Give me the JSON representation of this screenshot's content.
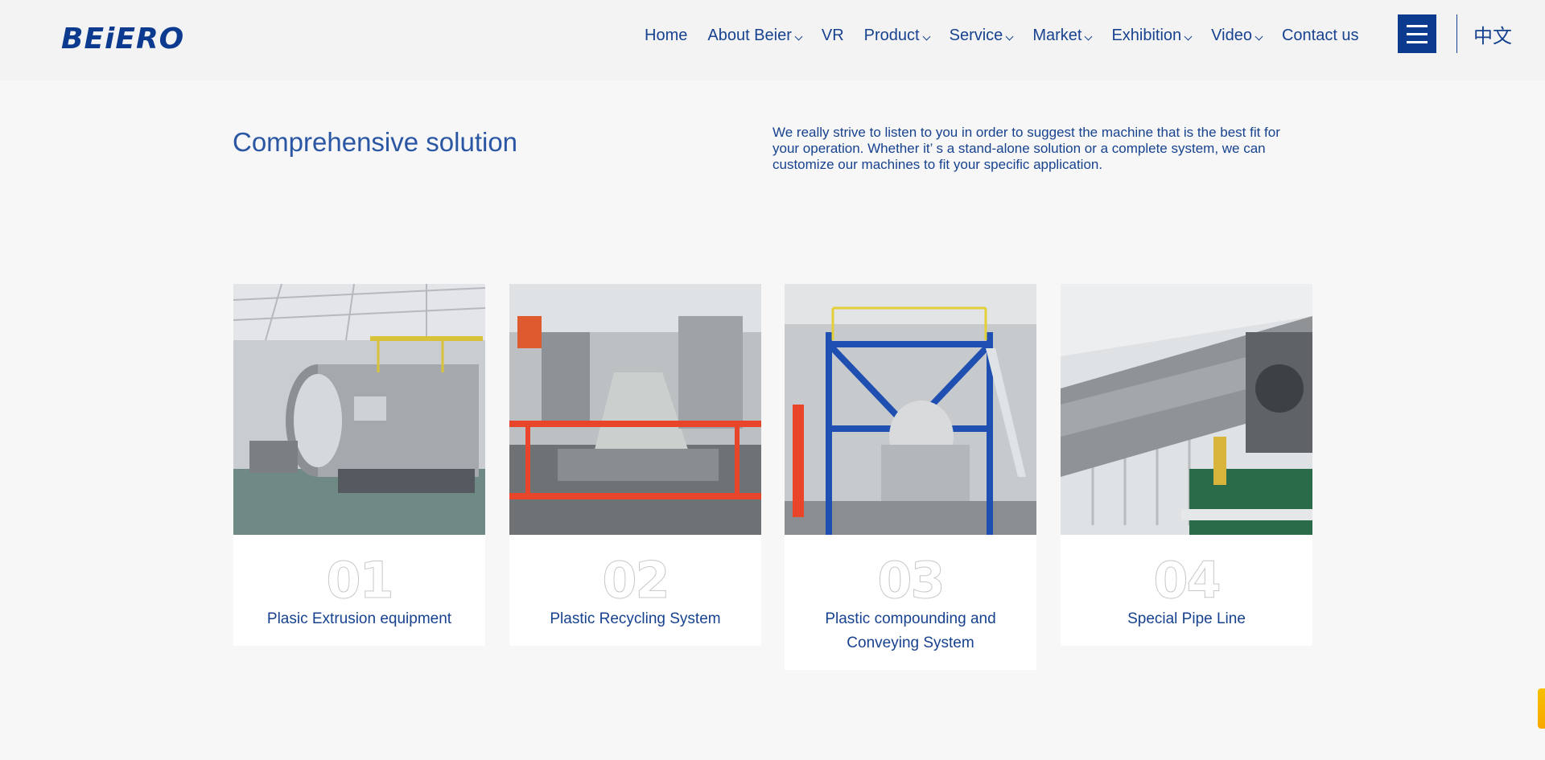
{
  "header": {
    "logo_text": "BEiERO",
    "nav": [
      {
        "label": "Home",
        "dropdown": false
      },
      {
        "label": "About Beier",
        "dropdown": true
      },
      {
        "label": "VR",
        "dropdown": false
      },
      {
        "label": "Product",
        "dropdown": true
      },
      {
        "label": "Service",
        "dropdown": true
      },
      {
        "label": "Market",
        "dropdown": true
      },
      {
        "label": "Exhibition",
        "dropdown": true
      },
      {
        "label": "Video",
        "dropdown": true
      },
      {
        "label": "Contact us",
        "dropdown": false
      }
    ],
    "menu_icon": "hamburger-icon",
    "language_label": "中文"
  },
  "intro": {
    "title": "Comprehensive solution",
    "description": "We really strive to listen to you in order to suggest the machine that is the best fit for your operation. Whether it’ s a stand-alone solution or a complete system, we can customize our machines to fit your specific application."
  },
  "cards": [
    {
      "number": "01",
      "title": "Plasic Extrusion equipment",
      "image": "extrusion-machine-photo"
    },
    {
      "number": "02",
      "title": "Plastic Recycling System",
      "image": "recycling-line-photo"
    },
    {
      "number": "03",
      "title": "Plastic compounding and Conveying System",
      "image": "compounding-tower-photo"
    },
    {
      "number": "04",
      "title": "Special Pipe Line",
      "image": "pipe-line-photo"
    }
  ],
  "colors": {
    "brand": "#0c3a8f",
    "text": "#17428f",
    "background": "#f7f7f7",
    "accent_orange": "#e8452a",
    "scroll_tab": "#f5c000"
  }
}
